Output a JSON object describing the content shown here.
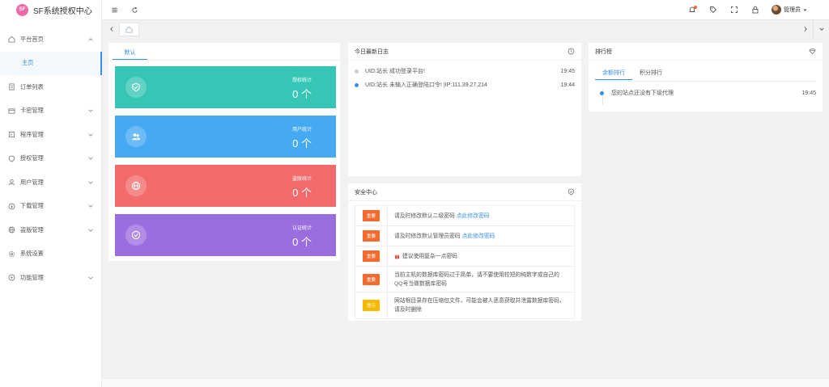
{
  "brand": {
    "name": "SF系统授权中心",
    "badge": "SF",
    "badge_color": "#f06aa8"
  },
  "accent": "#3a8ee6",
  "sidebar": {
    "items": [
      {
        "label": "平台首页",
        "icon": "home-icon",
        "expanded": true
      },
      {
        "label": "主页",
        "sub": true
      },
      {
        "label": "订单列表",
        "icon": "order-icon"
      },
      {
        "label": "卡密管理",
        "icon": "card-icon"
      },
      {
        "label": "程序管理",
        "icon": "program-icon"
      },
      {
        "label": "授权管理",
        "icon": "shield-icon"
      },
      {
        "label": "用户管理",
        "icon": "user-icon"
      },
      {
        "label": "下载管理",
        "icon": "download-icon"
      },
      {
        "label": "盗版管理",
        "icon": "globe-icon"
      },
      {
        "label": "系统设置",
        "icon": "gear-icon"
      },
      {
        "label": "功能管理",
        "icon": "function-icon"
      }
    ]
  },
  "header": {
    "user_name": "管理员"
  },
  "stats": {
    "tab": "默认",
    "cards": [
      {
        "label": "授权统计",
        "value": "0 个",
        "color": "#36c6b5",
        "icon": "shield-check-icon"
      },
      {
        "label": "用户统计",
        "value": "0 个",
        "color": "#45aaf2",
        "icon": "users-icon"
      },
      {
        "label": "盗版统计",
        "value": "0 个",
        "color": "#f36a6a",
        "icon": "globe-icon"
      },
      {
        "label": "认证统计",
        "value": "0 个",
        "color": "#9b6ee0",
        "icon": "check-circle-icon"
      }
    ]
  },
  "log": {
    "title": "今日最新日志",
    "items": [
      {
        "text": "UID:站长 成功登录平台!",
        "time": "19:45",
        "dot_color": "#cccccc"
      },
      {
        "text": "UID:站长 未输入正确登陆口令! |IP:111.39.27.214",
        "time": "19:44",
        "dot_color": "#3a8ee6"
      }
    ]
  },
  "security": {
    "title": "安全中心",
    "items": [
      {
        "badge": "重要",
        "badge_color": "#f36a2f",
        "text": "请及时修改默认二级密码",
        "link": "点此修改密码"
      },
      {
        "badge": "重要",
        "badge_color": "#f36a2f",
        "text": "请及时修改默认管理员密码",
        "link": "点此修改密码"
      },
      {
        "badge": "重要",
        "badge_color": "#f36a2f",
        "text": "建议使用复杂一点密码",
        "link": ""
      },
      {
        "badge": "重要",
        "badge_color": "#f36a2f",
        "text": "当前主机的数据库密码过于简单，请不要使用较短的纯数字或自己的QQ号当做数据库密码",
        "link": ""
      },
      {
        "badge": "提示",
        "badge_color": "#f7b800",
        "text": "网站根目录存在压缩包文件，可能会被人恶意获取并泄露数据库密码，请及时删除",
        "link": ""
      }
    ]
  },
  "ranking": {
    "title": "排行榜",
    "tabs": [
      "余额排行",
      "积分排行"
    ],
    "items": [
      {
        "text": "您的站点还没有下级代理",
        "time": "19:45"
      }
    ]
  }
}
